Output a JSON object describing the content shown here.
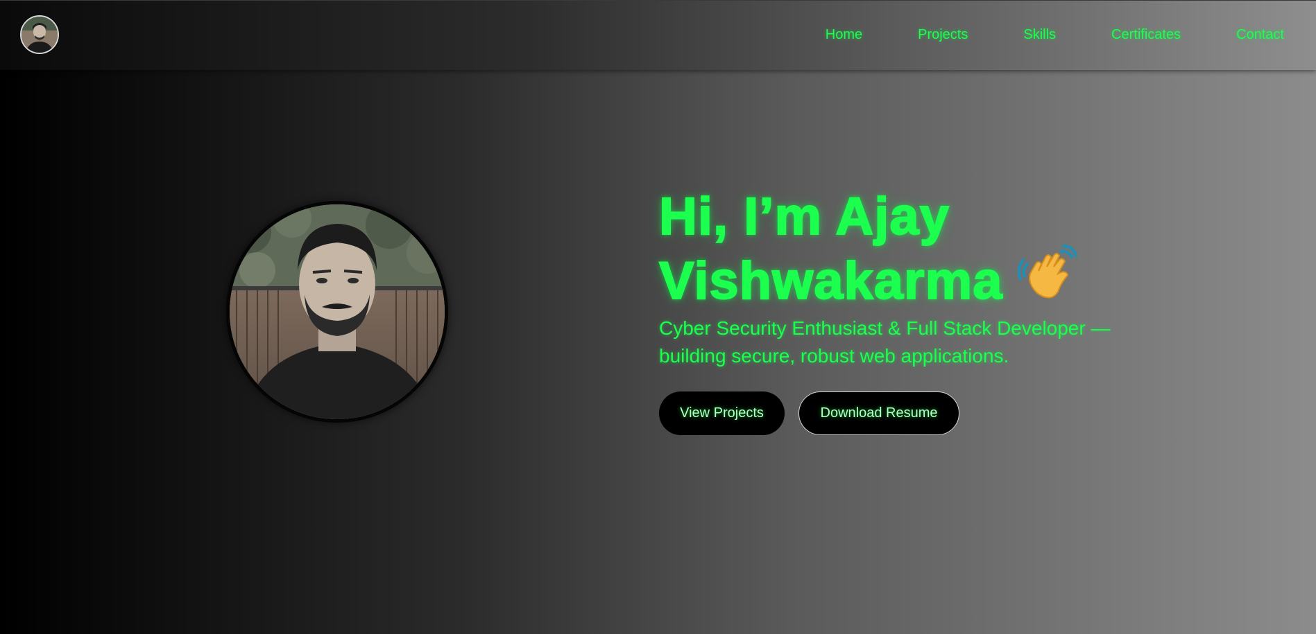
{
  "nav": {
    "links": [
      "Home",
      "Projects",
      "Skills",
      "Certificates",
      "Contact"
    ]
  },
  "hero": {
    "title_line1": "Hi, I’m Ajay",
    "title_line2": "Vishwakarma",
    "subtitle": "Cyber Security Enthusiast & Full Stack Developer — building secure, robust web applications.",
    "primary_button": "View Projects",
    "secondary_button": "Download Resume"
  },
  "icons": {
    "nav_avatar": "avatar-photo",
    "hero_photo": "profile-photo",
    "wave": "waving-hand-icon"
  },
  "colors": {
    "accent": "#1cff4f",
    "button_bg": "#000000",
    "button_text": "#b6ffc4"
  }
}
